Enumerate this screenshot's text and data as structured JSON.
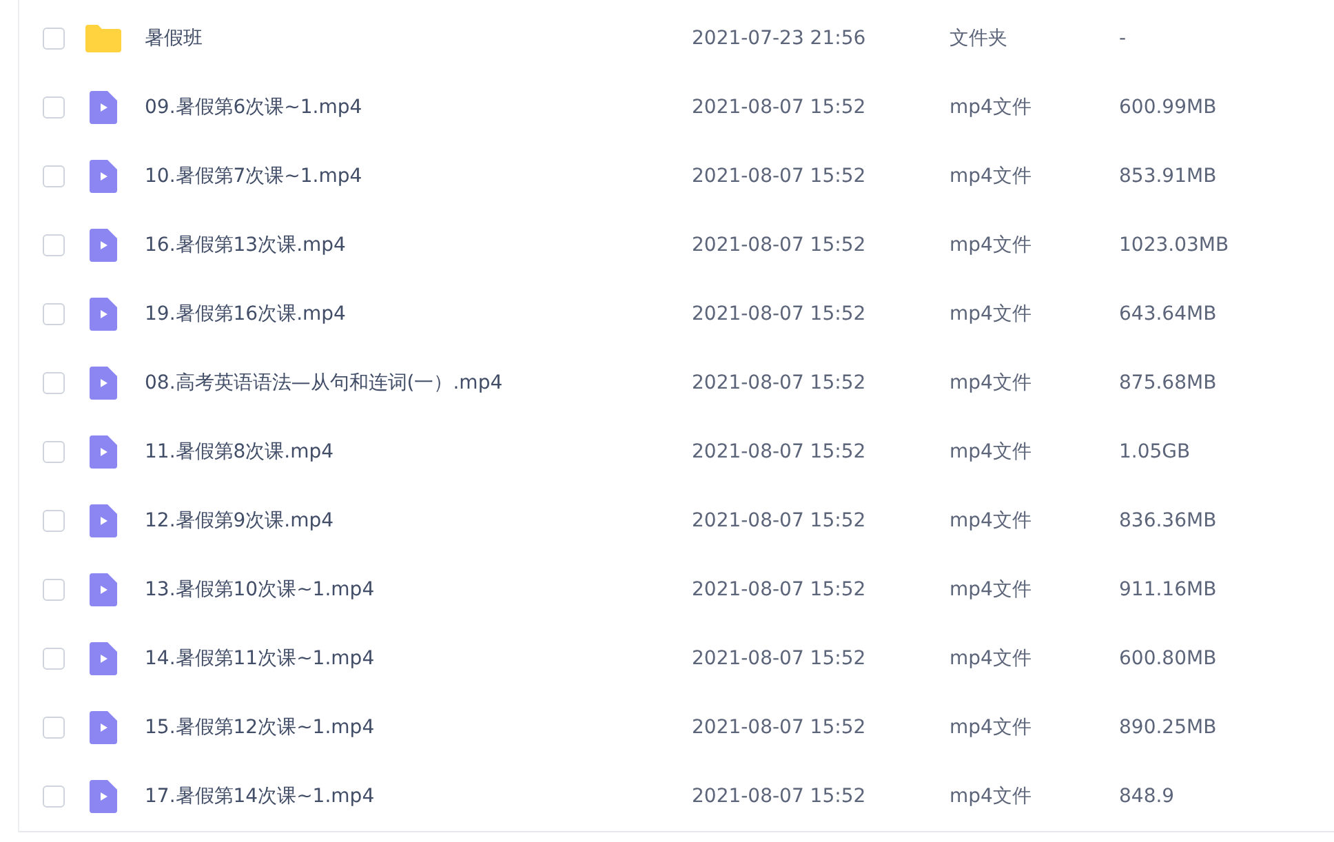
{
  "files": [
    {
      "kind": "folder",
      "name": "暑假班",
      "modified": "2021-07-23 21:56",
      "type": "文件夹",
      "size": "-",
      "checked": false
    },
    {
      "kind": "video",
      "name": "09.暑假第6次课~1.mp4",
      "modified": "2021-08-07 15:52",
      "type": "mp4文件",
      "size": "600.99MB",
      "checked": false
    },
    {
      "kind": "video",
      "name": "10.暑假第7次课~1.mp4",
      "modified": "2021-08-07 15:52",
      "type": "mp4文件",
      "size": "853.91MB",
      "checked": false
    },
    {
      "kind": "video",
      "name": "16.暑假第13次课.mp4",
      "modified": "2021-08-07 15:52",
      "type": "mp4文件",
      "size": "1023.03MB",
      "checked": false
    },
    {
      "kind": "video",
      "name": "19.暑假第16次课.mp4",
      "modified": "2021-08-07 15:52",
      "type": "mp4文件",
      "size": "643.64MB",
      "checked": false
    },
    {
      "kind": "video",
      "name": "08.高考英语语法—从句和连词(一）.mp4",
      "modified": "2021-08-07 15:52",
      "type": "mp4文件",
      "size": "875.68MB",
      "checked": false
    },
    {
      "kind": "video",
      "name": "11.暑假第8次课.mp4",
      "modified": "2021-08-07 15:52",
      "type": "mp4文件",
      "size": "1.05GB",
      "checked": false
    },
    {
      "kind": "video",
      "name": "12.暑假第9次课.mp4",
      "modified": "2021-08-07 15:52",
      "type": "mp4文件",
      "size": "836.36MB",
      "checked": false
    },
    {
      "kind": "video",
      "name": "13.暑假第10次课~1.mp4",
      "modified": "2021-08-07 15:52",
      "type": "mp4文件",
      "size": "911.16MB",
      "checked": false
    },
    {
      "kind": "video",
      "name": "14.暑假第11次课~1.mp4",
      "modified": "2021-08-07 15:52",
      "type": "mp4文件",
      "size": "600.80MB",
      "checked": false
    },
    {
      "kind": "video",
      "name": "15.暑假第12次课~1.mp4",
      "modified": "2021-08-07 15:52",
      "type": "mp4文件",
      "size": "890.25MB",
      "checked": false
    },
    {
      "kind": "video",
      "name": "17.暑假第14次课~1.mp4",
      "modified": "2021-08-07 15:52",
      "type": "mp4文件",
      "size": "848.9",
      "checked": false
    }
  ]
}
